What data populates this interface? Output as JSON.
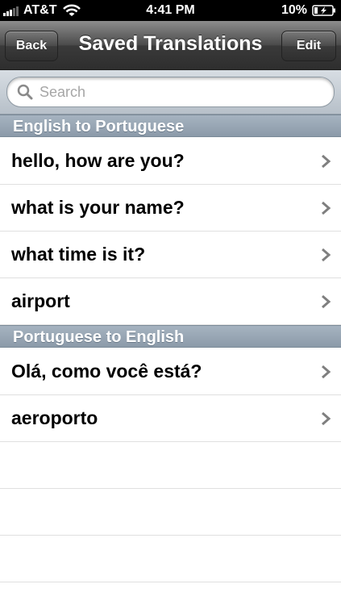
{
  "status_bar": {
    "carrier": "AT&T",
    "time": "4:41 PM",
    "battery": "10%"
  },
  "nav": {
    "title": "Saved Translations",
    "back_label": "Back",
    "edit_label": "Edit"
  },
  "search": {
    "placeholder": "Search",
    "value": ""
  },
  "sections": [
    {
      "header": "English to Portuguese",
      "items": [
        "hello, how are you?",
        "what is your name?",
        "what time is it?",
        "airport"
      ]
    },
    {
      "header": "Portuguese to English",
      "items": [
        "Olá, como você está?",
        "aeroporto"
      ]
    }
  ],
  "icons": {
    "search": "search-icon",
    "chevron": "chevron-right-icon",
    "wifi": "wifi-icon",
    "battery": "battery-icon",
    "signal": "signal-icon"
  },
  "colors": {
    "nav_bar": "#3a3a3a",
    "section_header": "#98a6b4",
    "search_bar": "#c3cbd3",
    "chevron": "#7f7f7f"
  }
}
